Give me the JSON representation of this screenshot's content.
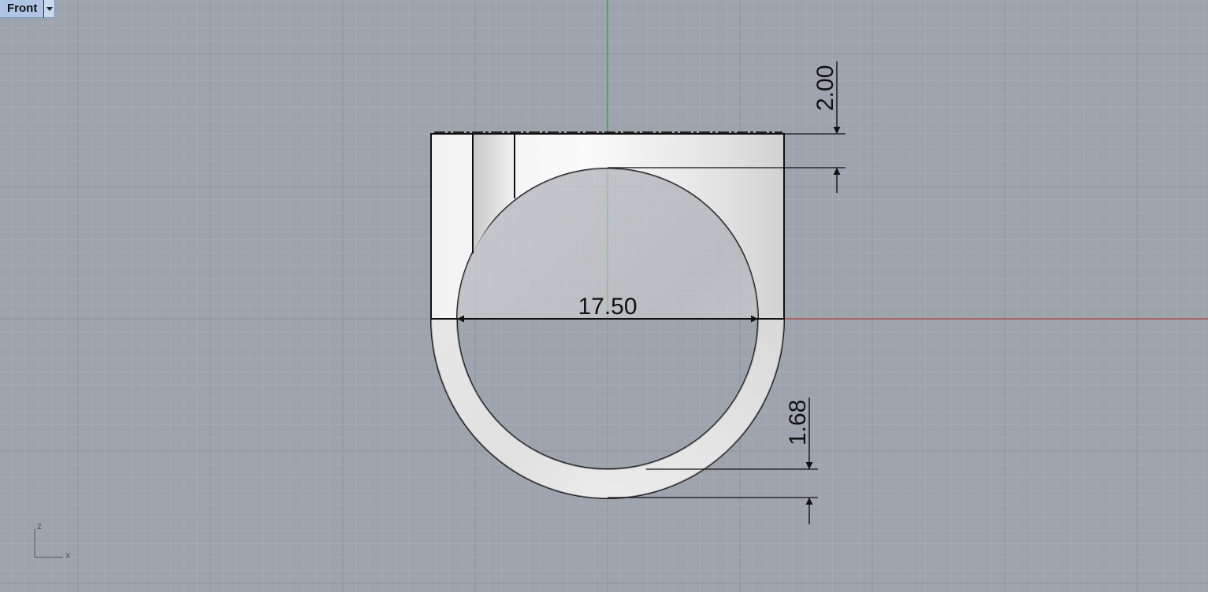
{
  "viewport": {
    "name": "Front",
    "background_color": "#9ea4ad",
    "grid_minor_color": "#a7adb5",
    "grid_major_color": "#8f959d",
    "x_axis_color": "#b0423a",
    "z_axis_color": "#2f9a3a"
  },
  "dimensions": {
    "top_thickness": "2.00",
    "inner_diameter": "17.50",
    "bottom_thickness": "1.68"
  },
  "axis_icon": {
    "vertical_label": "z",
    "horizontal_label": "x"
  },
  "icons": {
    "dropdown": "chevron-down-icon"
  }
}
